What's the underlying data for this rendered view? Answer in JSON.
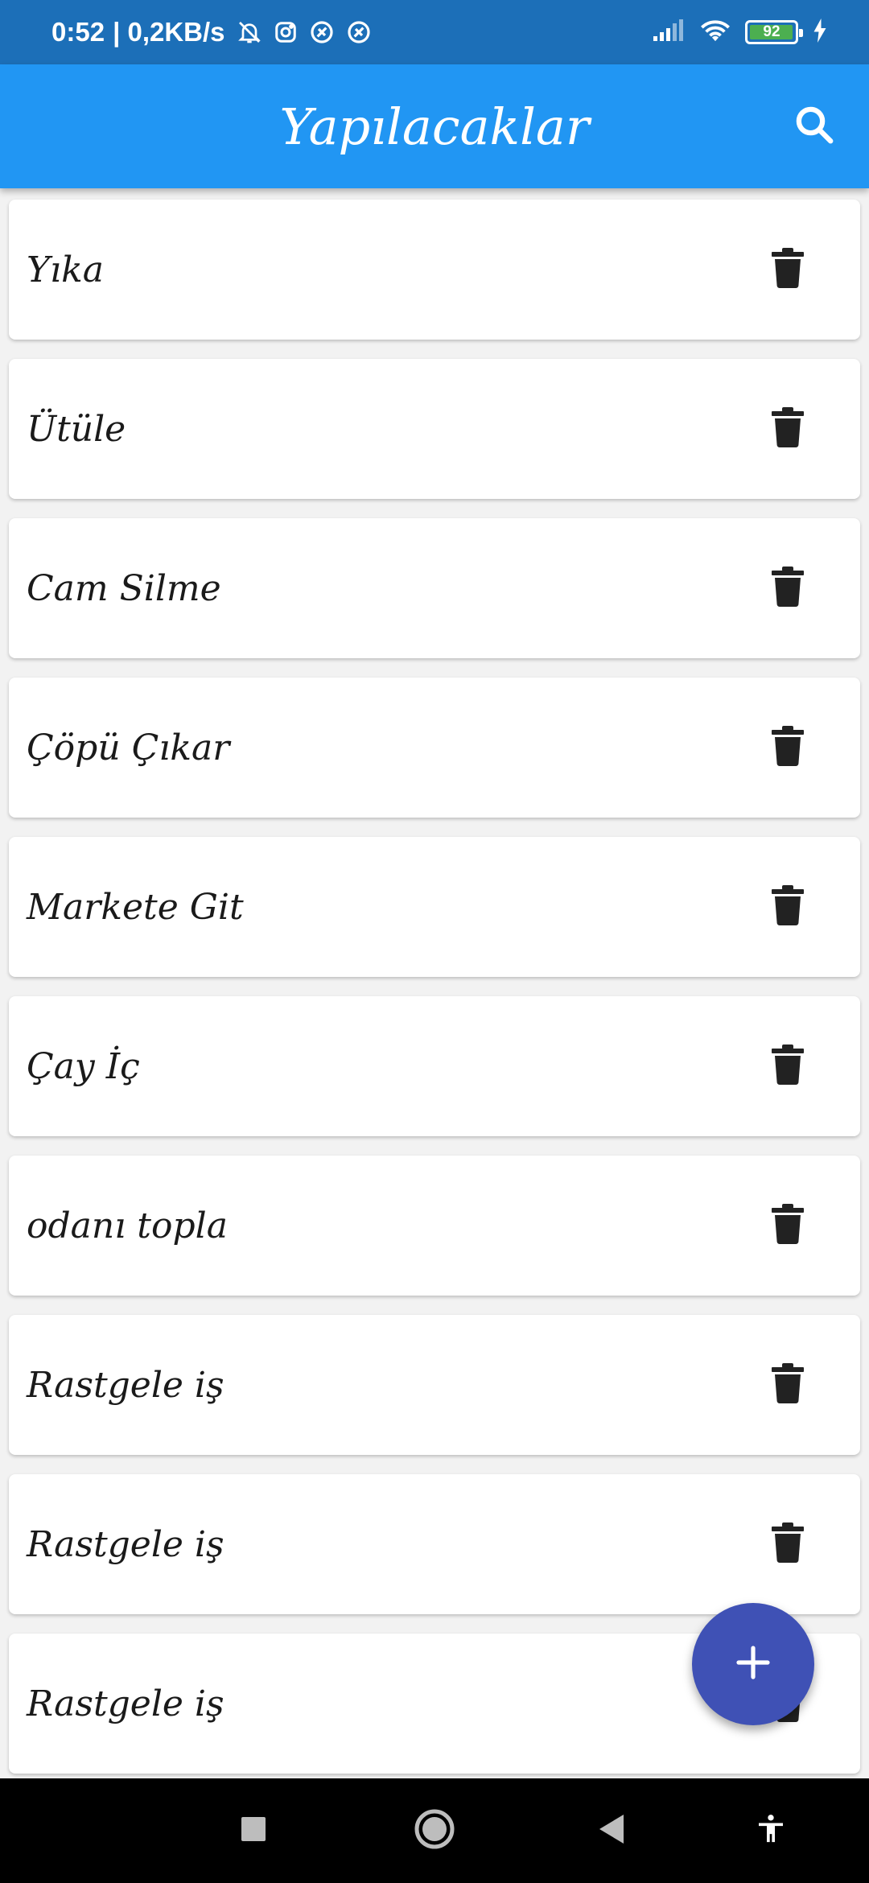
{
  "status_bar": {
    "time": "0:52",
    "network_speed": "| 0,2KB/s",
    "icons": [
      "bell-off-icon",
      "instagram-icon",
      "app-notification-icon",
      "app-notification-icon",
      "signal-icon",
      "wifi-icon",
      "battery-icon",
      "charging-icon"
    ],
    "battery_level": "92",
    "battery_color": "#4caf50"
  },
  "app_bar": {
    "title": "Yapılacaklar",
    "search_icon": "search-icon",
    "color": "#2196f3"
  },
  "todos": [
    {
      "title": "Yıka"
    },
    {
      "title": "Ütüle"
    },
    {
      "title": "Cam Silme"
    },
    {
      "title": "Çöpü Çıkar"
    },
    {
      "title": "Markete Git"
    },
    {
      "title": "Çay İç"
    },
    {
      "title": "odanı topla"
    },
    {
      "title": "Rastgele iş"
    },
    {
      "title": "Rastgele iş"
    },
    {
      "title": "Rastgele iş"
    }
  ],
  "item_action_icon": "trash-icon",
  "fab": {
    "icon": "plus-icon",
    "color": "#3f51b5"
  },
  "nav_bar": {
    "icons": [
      "square-recents-icon",
      "circle-home-icon",
      "triangle-back-icon",
      "accessibility-icon"
    ]
  }
}
